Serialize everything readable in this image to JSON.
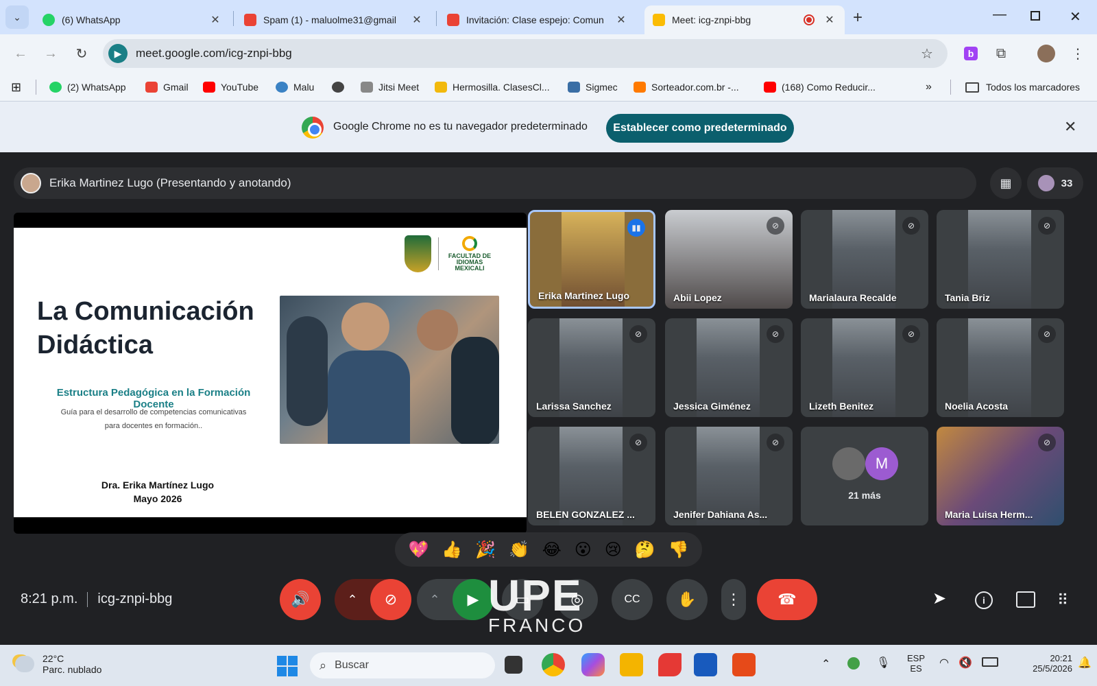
{
  "browser": {
    "tabs": [
      {
        "title": "(6) WhatsApp",
        "favicon": "whatsapp-icon",
        "color": "#25d366"
      },
      {
        "title": "Spam (1) - maluolme31@gmail",
        "favicon": "gmail-icon",
        "color": "#ea4335"
      },
      {
        "title": "Invitación: Clase espejo: Comun",
        "favicon": "gmail-icon",
        "color": "#ea4335"
      },
      {
        "title": "Meet: icg-znpi-bbg",
        "favicon": "meet-icon",
        "color": "#fbbc04",
        "active": true
      }
    ],
    "url": "meet.google.com/icg-znpi-bbg",
    "bookmarks": [
      {
        "label": "(2) WhatsApp",
        "icon": "whatsapp-icon",
        "color": "#25d366"
      },
      {
        "label": "Gmail",
        "icon": "gmail-icon",
        "color": "#ea4335"
      },
      {
        "label": "YouTube",
        "icon": "youtube-icon",
        "color": "#ff0000"
      },
      {
        "label": "Malu",
        "icon": "edge-icon",
        "color": "#3b82c4"
      },
      {
        "label": "",
        "icon": "globe-icon",
        "color": "#444444"
      },
      {
        "label": "Jitsi Meet",
        "icon": "jitsi-icon",
        "color": "#888888"
      },
      {
        "label": "Hermosilla. ClasesCl...",
        "icon": "classroom-icon",
        "color": "#f2b90d"
      },
      {
        "label": "Sigmec",
        "icon": "sigmec-icon",
        "color": "#3a6ea5"
      },
      {
        "label": "Sorteador.com.br -...",
        "icon": "sorteador-icon",
        "color": "#ff7a00"
      },
      {
        "label": "(168) Como Reducir...",
        "icon": "youtube-icon",
        "color": "#ff0000"
      }
    ],
    "all_bookmarks": "Todos los marcadores",
    "infobar": {
      "message": "Google Chrome no es tu navegador predeterminado",
      "button": "Establecer como predeterminado"
    }
  },
  "meet": {
    "presenter": "Erika Martinez Lugo (Presentando y anotando)",
    "participant_count": "33",
    "slide": {
      "title": "La Comunicación Didáctica",
      "subtitle": "Estructura Pedagógica en la Formación Docente",
      "description_1": "Guía para el desarrollo de competencias comunicativas",
      "description_2": "para docentes en formación..",
      "author": "Dra. Erika Martínez Lugo",
      "date": "Mayo 2026",
      "logo_text": "FACULTAD DE IDIOMAS MEXICALI"
    },
    "participants": [
      {
        "name": "Erika Martinez Lugo",
        "speaking": true
      },
      {
        "name": "Abii Lopez"
      },
      {
        "name": "Marialaura Recalde"
      },
      {
        "name": "Tania Briz"
      },
      {
        "name": "Larissa Sanchez"
      },
      {
        "name": "Jessica Giménez"
      },
      {
        "name": "Lizeth Benitez"
      },
      {
        "name": "Noelia Acosta"
      },
      {
        "name": "BELEN GONZALEZ ..."
      },
      {
        "name": "Jenifer Dahiana As..."
      },
      {
        "name": "21 más",
        "avatar_letter": "M"
      },
      {
        "name": "Maria Luisa Herm..."
      }
    ],
    "reactions": [
      "💖",
      "👍",
      "🎉",
      "👏",
      "😂",
      "😮",
      "😢",
      "🤔",
      "👎"
    ],
    "time": "8:21 p.m.",
    "meeting_code": "icg-znpi-bbg",
    "watermark_1": "UPE",
    "watermark_2": "FRANCO"
  },
  "taskbar": {
    "temperature": "22°C",
    "weather": "Parc. nublado",
    "search_placeholder": "Buscar",
    "lang_1": "ESP",
    "lang_2": "ES",
    "clock_time": "20:21",
    "clock_date": "25/5/2026"
  }
}
